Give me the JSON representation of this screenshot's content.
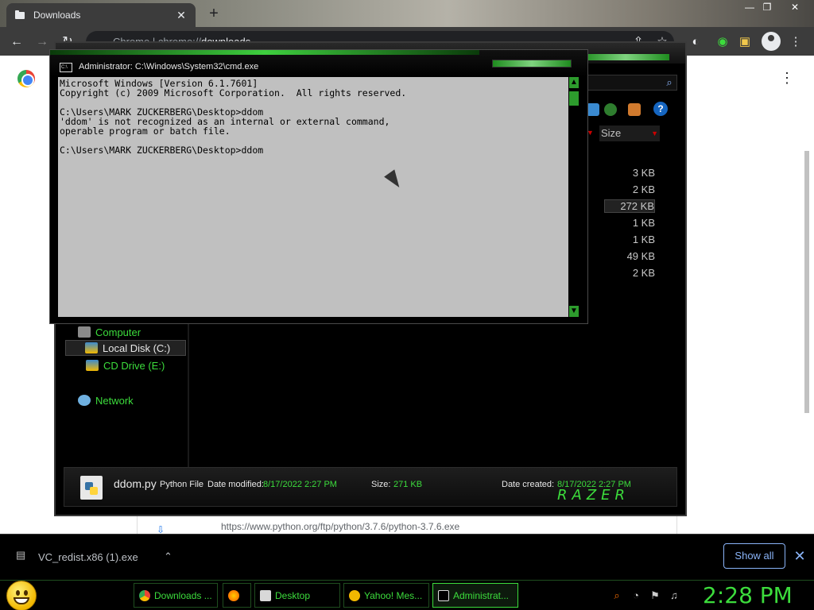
{
  "browser": {
    "tab_title": "Downloads",
    "new_tab_glyph": "+",
    "close_glyph": "✕",
    "omnibox_prefix": "Chrome  |  chrome://",
    "omnibox_host": "downloads",
    "more_glyph": "⋮",
    "win_min": "—",
    "win_max": "❐",
    "win_close": "✕"
  },
  "page": {
    "download_url": "https://www.python.org/ftp/python/3.7.6/python-3.7.6.exe"
  },
  "explorer": {
    "column_size": "Size",
    "sizes": [
      "3 KB",
      "2 KB",
      "272 KB",
      "1 KB",
      "1 KB",
      "49 KB",
      "2 KB"
    ],
    "nav": {
      "computer": "Computer",
      "local_disk": "Local Disk (C:)",
      "cd_drive": "CD Drive (E:)",
      "network": "Network"
    },
    "details": {
      "file_name": "ddom.py",
      "file_type": "Python File",
      "date_modified_label": "Date modified:",
      "date_modified_value": "8/17/2022 2:27 PM",
      "size_label": "Size:",
      "size_value": "271 KB",
      "date_created_label": "Date created:",
      "date_created_value": "8/17/2022 2:27 PM",
      "brand": "RAZER"
    },
    "help_glyph": "?"
  },
  "cmd": {
    "title": "Administrator: C:\\Windows\\System32\\cmd.exe",
    "icon_text": "C:\\",
    "lines": "Microsoft Windows [Version 6.1.7601]\nCopyright (c) 2009 Microsoft Corporation.  All rights reserved.\n\nC:\\Users\\MARK ZUCKERBERG\\Desktop>ddom\n'ddom' is not recognized as an internal or external command,\noperable program or batch file.\n\nC:\\Users\\MARK ZUCKERBERG\\Desktop>ddom"
  },
  "shelf": {
    "file_name": "VC_redist.x86 (1).exe",
    "caret": "⌃",
    "show_all": "Show all",
    "close": "✕"
  },
  "taskbar": {
    "buttons": [
      "Downloads ...",
      "",
      "Desktop",
      "Yahoo! Mes...",
      "Administrat..."
    ],
    "clock": "2:28 PM"
  },
  "colors": {
    "accent_green": "#3cdc3c",
    "chrome_dark": "#3c3c3c",
    "link_blue": "#8ab4f8"
  }
}
